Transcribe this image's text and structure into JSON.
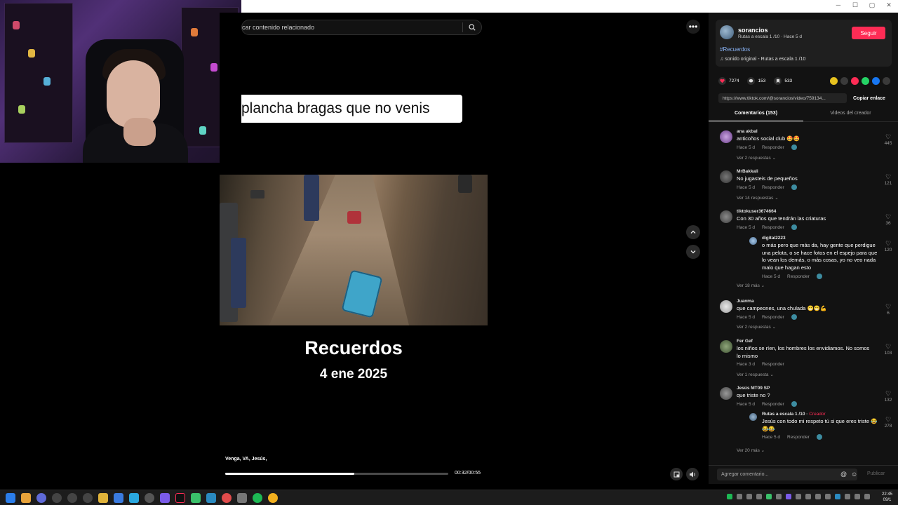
{
  "player": {
    "search_placeholder": "car contenido relacionado",
    "caption": "plancha bragas que no venis",
    "video_title": "Recuerdos",
    "video_date": "4 ene 2025",
    "subtitle": "Venga, VA, Jesús,",
    "time": "00:32/00:55",
    "progress": 0.58
  },
  "post": {
    "author": "sorancios",
    "author_sub": "Rutas a escala 1 /10 · Hace 5 d",
    "follow_label": "Seguir",
    "hashtag": "#Recuerdos",
    "sound": "sonido original - Rutas a escala 1 /10",
    "likes": "7274",
    "comments": "153",
    "saves": "533",
    "link": "https://www.tiktok.com/@sorancios/video/759134...",
    "copy_label": "Copiar enlace"
  },
  "tabs": {
    "comments": "Comentarios (153)",
    "creator_videos": "Videos del creador"
  },
  "comments": [
    {
      "user": "ana akbal",
      "text": "anticoños social club 🤩🤩",
      "time": "Hace 5 d",
      "reply": "Responder",
      "likes": "445",
      "more": "Ver 2 respuestas ⌄"
    },
    {
      "user": "MrBakkali",
      "text": "No jugasteis de pequeños",
      "time": "Hace 5 d",
      "reply": "Responder",
      "likes": "121",
      "more": "Ver 14 respuestas ⌄"
    },
    {
      "user": "tiktokuser3674664",
      "text": "Con 30 años que tendrán las criaturas",
      "time": "Hace 5 d",
      "reply": "Responder",
      "likes": "36"
    },
    {
      "user": "Juanma",
      "text": "que campeones, una chulada 😁😁💪",
      "time": "Hace 5 d",
      "reply": "Responder",
      "likes": "6",
      "more": "Ver 2 respuestas ⌄"
    },
    {
      "user": "Fer Gef",
      "text": "los niños se ríen, los hombres los envidiamos. No somos lo mismo",
      "time": "Hace 3 d",
      "reply": "Responder",
      "likes": "103",
      "more": "Ver 1 respuesta ⌄"
    },
    {
      "user": "Jesús MT09 SP",
      "text": "que triste no ?",
      "time": "Hace 5 d",
      "reply": "Responder",
      "likes": "132"
    }
  ],
  "replies": {
    "r1": {
      "user": "digital2223",
      "text": "o más pero que más da, hay gente que perdigue una pelota, o se hace fotos en el espejo para que lo vean los demás, o más cosas, yo no veo nada malo que hagan esto",
      "time": "Hace 5 d",
      "reply": "Responder",
      "likes": "120",
      "more": "Ver 18 más ⌄"
    },
    "r2": {
      "user": "Rutas a escala 1 /10 · ",
      "creator": "Creador",
      "text": "Jesús con todo mi respeto tú si que eres triste 😂😂😂",
      "time": "Hace 5 d",
      "reply": "Responder",
      "likes": "278",
      "more": "Ver 20 más ⌄"
    }
  },
  "compose": {
    "placeholder": "Agregar comentario...",
    "publish": "Publicar"
  },
  "taskbar": {
    "time": "22:45",
    "date": "09/1"
  },
  "colors": {
    "accent": "#fe2c55",
    "hashtag": "#8ab4f8",
    "panel": "#121212"
  }
}
